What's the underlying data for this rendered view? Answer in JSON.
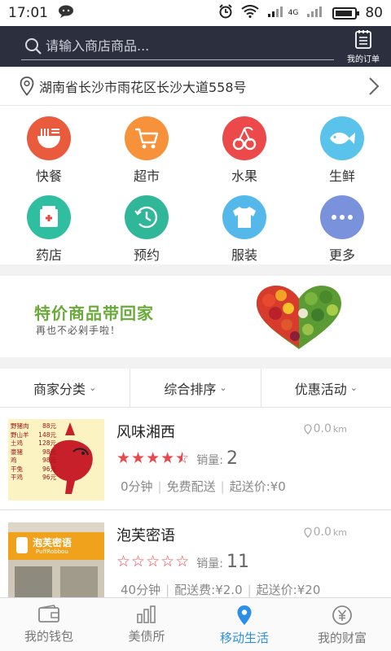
{
  "status_bar": {
    "time": "17:01",
    "network": "4G",
    "battery": "80"
  },
  "header": {
    "search_placeholder": "请输入商店商品...",
    "my_orders_label": "我的订单"
  },
  "address": {
    "text": "湖南省长沙市雨花区长沙大道558号"
  },
  "categories": [
    {
      "label": "快餐",
      "icon": "noodle-bowl-icon",
      "color": "#ea5a3c"
    },
    {
      "label": "超市",
      "icon": "shopping-cart-icon",
      "color": "#f7923a"
    },
    {
      "label": "水果",
      "icon": "cherry-icon",
      "color": "#ec4a4a"
    },
    {
      "label": "生鲜",
      "icon": "fish-icon",
      "color": "#5ac3ec"
    },
    {
      "label": "药店",
      "icon": "medicine-icon",
      "color": "#2fbfa0"
    },
    {
      "label": "预约",
      "icon": "clock-icon",
      "color": "#30b79a"
    },
    {
      "label": "服装",
      "icon": "tshirt-icon",
      "color": "#54b9ea"
    },
    {
      "label": "更多",
      "icon": "more-icon",
      "color": "#7a91dc"
    }
  ],
  "banner": {
    "title": "特价商品带回家",
    "subtitle": "再也不必剁手啦！"
  },
  "filters": [
    {
      "label": "商家分类"
    },
    {
      "label": "综合排序"
    },
    {
      "label": "优惠活动"
    }
  ],
  "stores": [
    {
      "name": "风味湘西",
      "distance": "0.0",
      "distance_unit": "km",
      "rating": 4.5,
      "sales_label": "销量:",
      "sales": "2",
      "time": "0分钟",
      "delivery": "免费配送",
      "min_order": "起送价:¥0",
      "thumb_menu": [
        "野猪肉",
        "野山羊",
        "土鸡",
        "豪猪",
        "鸡",
        "干兔",
        "干鸡"
      ],
      "thumb_prices": [
        "88元",
        "148元",
        "128元",
        "98元",
        "98元",
        "96元",
        "96元"
      ]
    },
    {
      "name": "泡芙密语",
      "distance": "0.0",
      "distance_unit": "km",
      "rating": 0,
      "sales_label": "销量:",
      "sales": "11",
      "time": "40分钟",
      "delivery": "配送费:¥2.0",
      "min_order": "起送价:¥20",
      "thumb_sign": "泡芙密语",
      "thumb_sign_sub": "PuffRobbou"
    }
  ],
  "bottom_nav": [
    {
      "label": "我的钱包",
      "icon": "wallet-icon",
      "active": false
    },
    {
      "label": "美债所",
      "icon": "bar-chart-icon",
      "active": false
    },
    {
      "label": "移动生活",
      "icon": "location-pin-icon",
      "active": true
    },
    {
      "label": "我的财富",
      "icon": "yuan-coin-icon",
      "active": false
    }
  ],
  "colors": {
    "header_bg": "#2b2f3e",
    "accent": "#2d8ee6",
    "star": "#e8494e",
    "banner_green": "#6aaa3a"
  }
}
